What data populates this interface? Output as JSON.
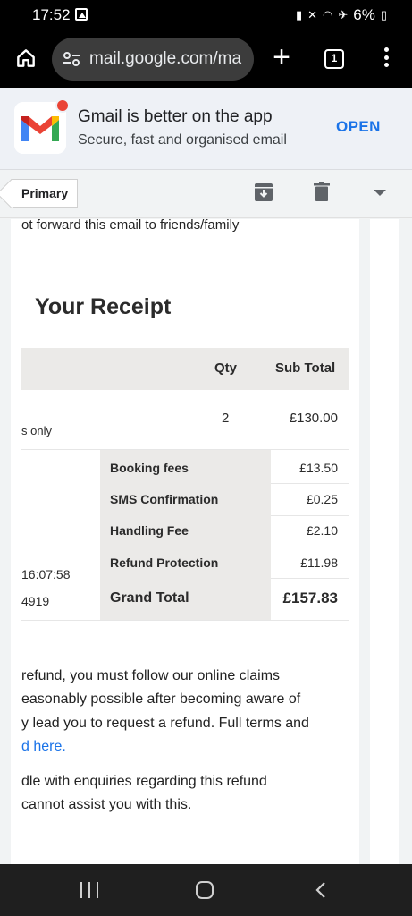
{
  "status": {
    "time": "17:52",
    "battery": "6%"
  },
  "browser": {
    "url": "mail.google.com/ma",
    "tab_count": "1"
  },
  "banner": {
    "title": "Gmail is better on the app",
    "subtitle": "Secure, fast and organised email",
    "open_label": "OPEN"
  },
  "toolbar": {
    "label_tag": "Primary"
  },
  "email": {
    "top_note": "ot forward this email to friends/family",
    "receipt_title": "Your Receipt",
    "table": {
      "col_qty": "Qty",
      "col_subtotal": "Sub Total",
      "row_desc": "s only",
      "row_qty": "2",
      "row_subtotal": "£130.00"
    },
    "fees": [
      {
        "label": "Booking fees",
        "value": "£13.50"
      },
      {
        "label": "SMS Confirmation",
        "value": "£0.25"
      },
      {
        "label": "Handling Fee",
        "value": "£2.10"
      },
      {
        "label": "Refund Protection",
        "value": "£11.98"
      }
    ],
    "grand_total_label": "Grand Total",
    "grand_total_value": "£157.83",
    "left_time": "16:07:58",
    "left_ref": "4919",
    "para1": [
      " refund, you must follow our online claims",
      "easonably possible after becoming aware of",
      "y lead you to request a refund. Full terms and"
    ],
    "para1_link": "d here.",
    "para2": [
      "dle with enquiries regarding this refund",
      " cannot assist you with this."
    ]
  }
}
